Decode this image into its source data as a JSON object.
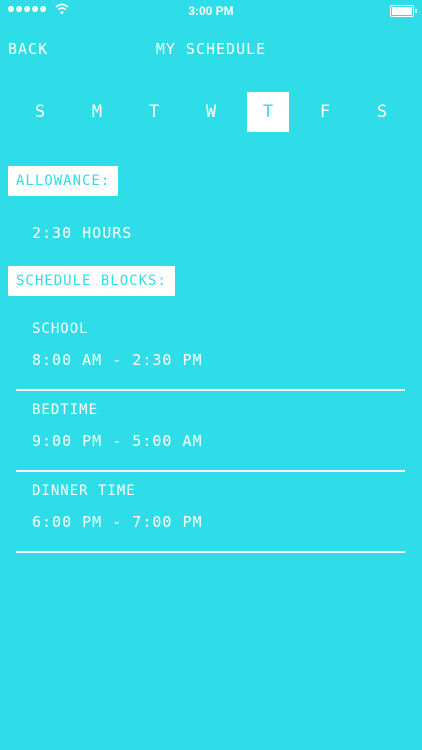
{
  "status_bar": {
    "time": "3:00 PM"
  },
  "nav": {
    "back_label": "BACK",
    "title": "MY SCHEDULE"
  },
  "days": [
    {
      "label": "S",
      "selected": false
    },
    {
      "label": "M",
      "selected": false
    },
    {
      "label": "T",
      "selected": false
    },
    {
      "label": "W",
      "selected": false
    },
    {
      "label": "T",
      "selected": true
    },
    {
      "label": "F",
      "selected": false
    },
    {
      "label": "S",
      "selected": false
    }
  ],
  "allowance": {
    "label": "ALLOWANCE:",
    "value": "2:30 HOURS"
  },
  "schedule": {
    "label": "SCHEDULE BLOCKS:",
    "blocks": [
      {
        "name": "SCHOOL",
        "time": "8:00 AM - 2:30 PM"
      },
      {
        "name": "BEDTIME",
        "time": "9:00 PM - 5:00 AM"
      },
      {
        "name": "DINNER TIME",
        "time": "6:00 PM - 7:00 PM"
      }
    ]
  },
  "colors": {
    "background": "#2fdde9",
    "foreground": "#ffffff"
  }
}
